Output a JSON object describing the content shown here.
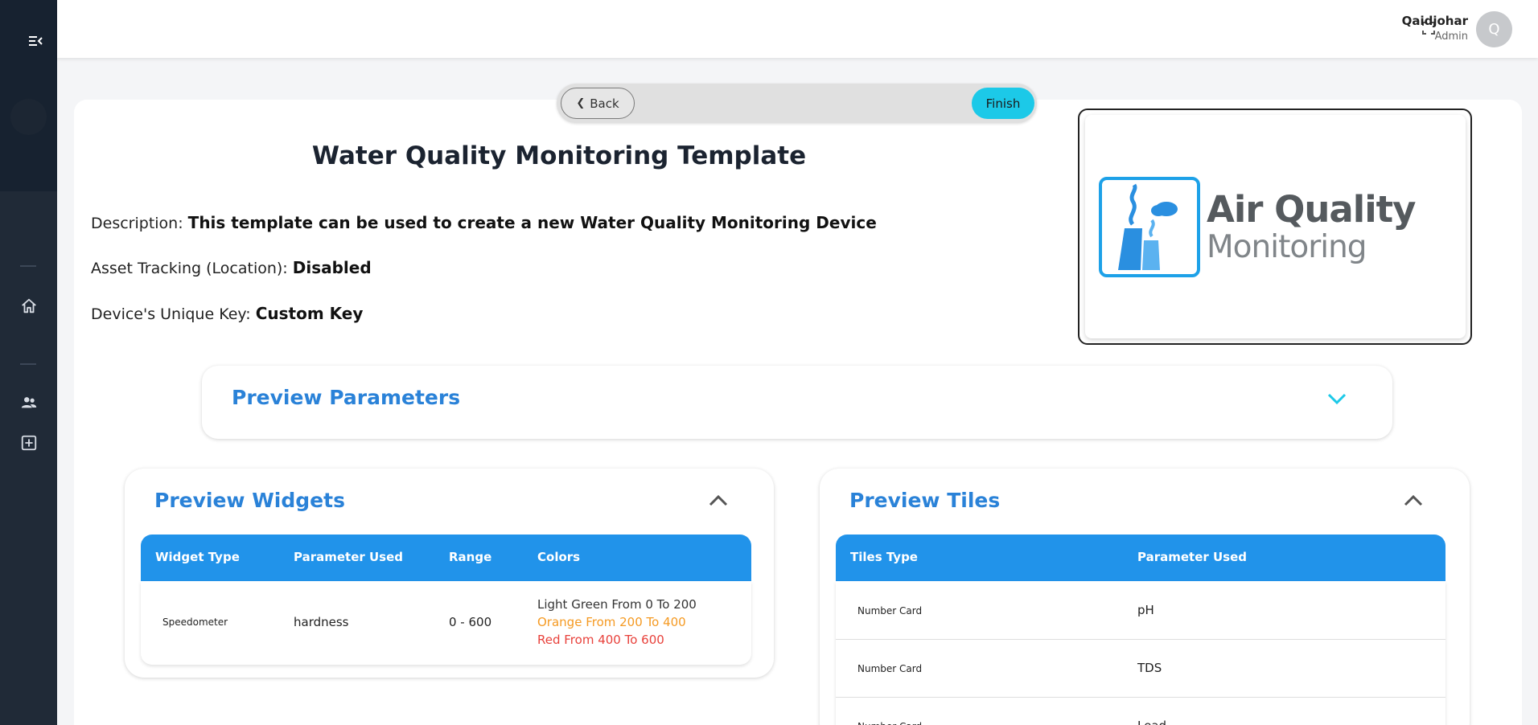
{
  "header": {
    "user_name": "Qaidjohar",
    "user_role": "Admin",
    "avatar_initial": "Q"
  },
  "nav": {
    "back_label": "Back",
    "finish_label": "Finish"
  },
  "template": {
    "title": "Water Quality Monitoring Template",
    "description_label": "Description:",
    "description_value": "This template can be used to create a new Water Quality Monitoring Device",
    "asset_tracking_label": "Asset Tracking (Location):",
    "asset_tracking_value": "Disabled",
    "unique_key_label": "Device's Unique Key:",
    "unique_key_value": "Custom Key"
  },
  "logo": {
    "title": "Air Quality",
    "subtitle": "Monitoring"
  },
  "preview_parameters": {
    "title": "Preview Parameters"
  },
  "preview_widgets": {
    "title": "Preview Widgets",
    "columns": [
      "Widget Type",
      "Parameter Used",
      "Range",
      "Colors"
    ],
    "rows": [
      {
        "widget_type": "Speedometer",
        "parameter": "hardness",
        "range": "0 - 600",
        "colors": [
          {
            "text": "Light Green  From 0 To 200",
            "color": "#333333"
          },
          {
            "text": "Orange  From 200 To 400",
            "color": "#f59a23"
          },
          {
            "text": "Red  From 400 To 600",
            "color": "#e8413b"
          }
        ]
      }
    ]
  },
  "preview_tiles": {
    "title": "Preview Tiles",
    "columns": [
      "Tiles Type",
      "Parameter Used"
    ],
    "rows": [
      {
        "type": "Number Card",
        "parameter": "pH"
      },
      {
        "type": "Number Card",
        "parameter": "TDS"
      },
      {
        "type": "Number Card",
        "parameter": "Lead"
      }
    ]
  },
  "colors": {
    "accent": "#2193ea",
    "finish": "#1cc9e8",
    "sidebar": "#202a37",
    "title_blue": "#2a82d8"
  }
}
